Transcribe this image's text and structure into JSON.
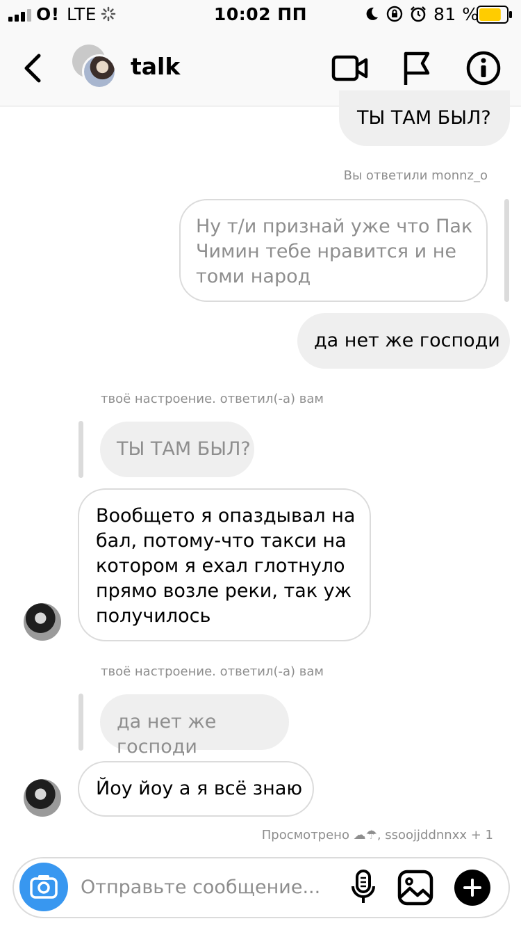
{
  "status_bar": {
    "carrier": "O!",
    "network": "LTE",
    "time": "10:02 ПП",
    "battery_percent": "81 %",
    "battery_level": 0.81,
    "battery_color": "#ffcc00"
  },
  "header": {
    "title": "talk",
    "icons": [
      "back-icon",
      "video-call-icon",
      "flag-icon",
      "info-icon"
    ]
  },
  "messages": [
    {
      "type": "outgoing",
      "text": "ТЫ ТАМ БЫЛ?"
    },
    {
      "type": "reply_meta_right",
      "text": "Вы ответили monnz_o"
    },
    {
      "type": "outgoing_quote",
      "text": "Ну т/и признай уже что Пак Чимин тебе нравится и не томи народ"
    },
    {
      "type": "outgoing",
      "text": "да нет же господи"
    },
    {
      "type": "reply_meta_left",
      "text": "твоё настроение. ответил(-а) вам"
    },
    {
      "type": "quoted",
      "text": "ТЫ ТАМ БЫЛ?"
    },
    {
      "type": "incoming",
      "text": "Вообщето я опаздывал на бал, потому-что такси на котором я ехал глотнуло прямо возле реки, так уж получилось"
    },
    {
      "type": "reply_meta_left",
      "text": "твоё настроение. ответил(-а) вам"
    },
    {
      "type": "quoted",
      "text": "да нет же господи"
    },
    {
      "type": "incoming",
      "text": "Йоу йоу а я всё знаю"
    }
  ],
  "seen": "Просмотрено ☁︎☂︎, ssoojjddnnxx + 1",
  "composer": {
    "placeholder": "Отправьте сообщение...",
    "icons": [
      "camera-icon",
      "microphone-icon",
      "gallery-icon",
      "plus-icon"
    ],
    "accent": "#3897f0"
  }
}
